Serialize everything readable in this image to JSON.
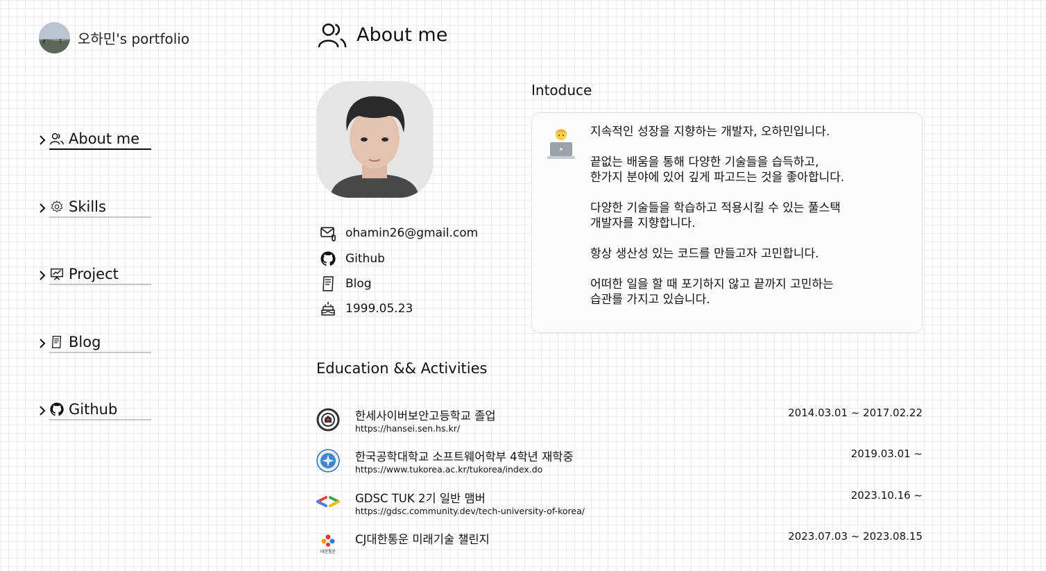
{
  "brand": {
    "title": "오하민's portfolio"
  },
  "nav": {
    "items": [
      {
        "label": "About me",
        "icon": "users-icon",
        "active": true
      },
      {
        "label": "Skills",
        "icon": "gear-icon",
        "active": false
      },
      {
        "label": "Project",
        "icon": "presentation-icon",
        "active": false
      },
      {
        "label": "Blog",
        "icon": "notebook-icon",
        "active": false
      },
      {
        "label": "Github",
        "icon": "github-icon",
        "active": false
      }
    ]
  },
  "header": {
    "title": "About me",
    "icon": "users-icon"
  },
  "profile": {
    "contacts": [
      {
        "label": "ohamin26@gmail.com",
        "icon": "mail-icon"
      },
      {
        "label": "Github",
        "icon": "github-icon"
      },
      {
        "label": "Blog",
        "icon": "notebook-icon"
      },
      {
        "label": "1999.05.23",
        "icon": "cake-icon"
      }
    ]
  },
  "introduce": {
    "heading": "Intoduce",
    "emoji": "technologist-emoji",
    "paragraphs": [
      "지속적인 성장을 지향하는 개발자, 오하민입니다.",
      "끝없는 배움을 통해 다양한 기술들을 습득하고,\n한가지 분야에 있어 깊게 파고드는 것을 좋아합니다.",
      "다양한 기술들을 학습하고 적용시킬 수 있는 풀스택\n개발자를 지향합니다.",
      "항상 생산성 있는 코드를 만들고자 고민합니다.",
      "어떠한 일을 할 때 포기하지 않고 끝까지 고민하는\n습관를 가지고 있습니다."
    ]
  },
  "education": {
    "heading": "Education && Activities",
    "items": [
      {
        "name": "한세사이버보안고등학교 졸업",
        "url": "https://hansei.sen.hs.kr/",
        "period": "2014.03.01 ~ 2017.02.22",
        "logo": "hansei-logo"
      },
      {
        "name": "한국공학대학교 소프트웨어학부 4학년 재학중",
        "url": "https://www.tukorea.ac.kr/tukorea/index.do",
        "period": "2019.03.01 ~",
        "logo": "tukorea-logo"
      },
      {
        "name": "GDSC TUK 2기 일반 맴버",
        "url": "https://gdsc.community.dev/tech-university-of-korea/",
        "period": "2023.10.16 ~",
        "logo": "gdsc-logo"
      },
      {
        "name": "CJ대한통운 미래기술 챌린지",
        "url": "",
        "period": "2023.07.03 ~ 2023.08.15",
        "logo": "cj-logo",
        "logo_caption": "대한통운"
      }
    ]
  }
}
